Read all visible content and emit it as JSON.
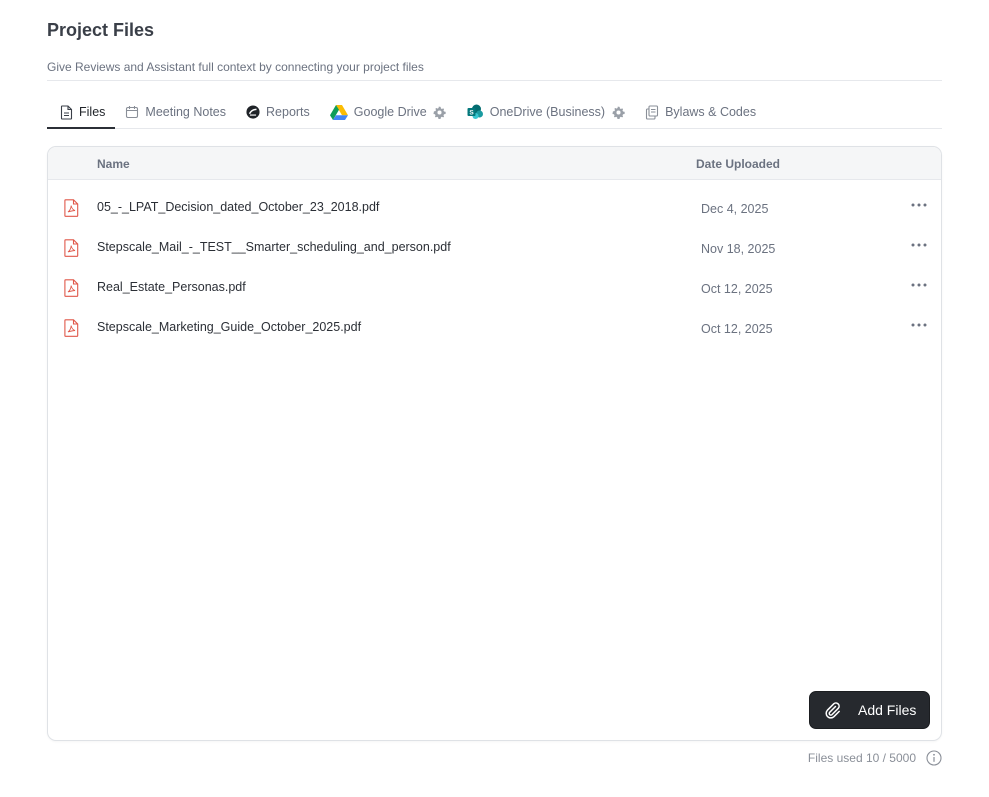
{
  "page": {
    "title": "Project Files",
    "subtitle": "Give Reviews and Assistant full context by connecting your project files"
  },
  "tabs": [
    {
      "label": "Files",
      "icon": "file-icon",
      "active": true
    },
    {
      "label": "Meeting Notes",
      "icon": "calendar-icon",
      "active": false
    },
    {
      "label": "Reports",
      "icon": "reports-icon",
      "active": false
    },
    {
      "label": "Google Drive",
      "icon": "google-drive-icon",
      "active": false,
      "settings": true
    },
    {
      "label": "OneDrive (Business)",
      "icon": "sharepoint-icon",
      "active": false,
      "settings": true
    },
    {
      "label": "Bylaws & Codes",
      "icon": "copy-icon",
      "active": false
    }
  ],
  "table": {
    "columns": {
      "name": "Name",
      "date": "Date Uploaded"
    },
    "rows": [
      {
        "name": "05_-_LPAT_Decision_dated_October_23_2018.pdf",
        "date": "Dec 4, 2025",
        "icon": "pdf-icon"
      },
      {
        "name": "Stepscale_Mail_-_TEST__Smarter_scheduling_and_person.pdf",
        "date": "Nov 18, 2025",
        "icon": "pdf-icon"
      },
      {
        "name": "Real_Estate_Personas.pdf",
        "date": "Oct 12, 2025",
        "icon": "pdf-icon"
      },
      {
        "name": "Stepscale_Marketing_Guide_October_2025.pdf",
        "date": "Oct 12, 2025",
        "icon": "pdf-icon"
      }
    ]
  },
  "actions": {
    "add_files_label": "Add Files"
  },
  "footer": {
    "usage_text": "Files used 10 / 5000"
  },
  "colors": {
    "accent_dark": "#26292e",
    "pdf_red": "#e0584a",
    "muted": "#6b7280",
    "border": "#dfe2e6"
  }
}
